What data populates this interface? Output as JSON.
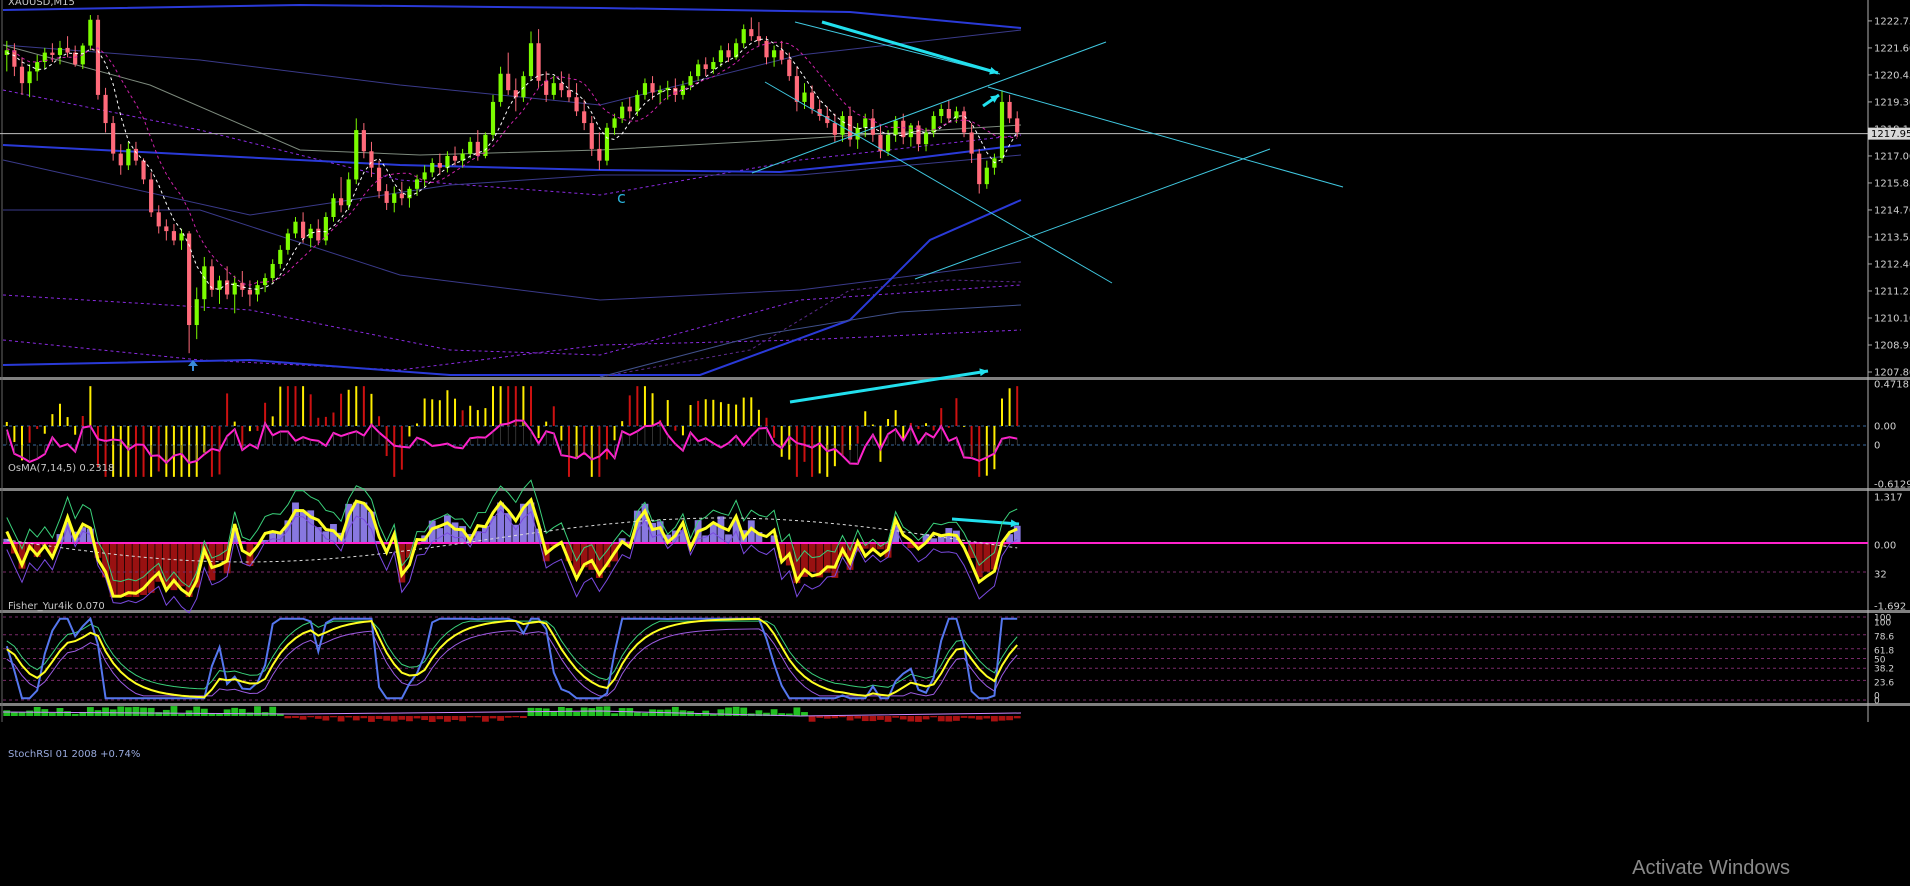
{
  "window": {
    "symbol_title": "XAUUSD,M15"
  },
  "watermark": "Activate Windows",
  "colors": {
    "background": "#000000",
    "bull_candle": "#7cfc00",
    "bear_candle": "#ff6a7a",
    "trendline": "#40c8e0",
    "arrow": "#22e0ee",
    "ma_blue": "#2a3ad8",
    "ma_purple": "#8a2be2",
    "signal_magenta": "#ff22cc",
    "osma_up": "#ffee00",
    "osma_down": "#cc1111",
    "fisher_line": "#ffff22",
    "fisher_pos": "#8878e0",
    "fisher_neg": "#991111",
    "stoch_blue": "#5577ee",
    "axis_text": "#d0d0d0",
    "separator": "#808080"
  },
  "chart_data": [
    {
      "panel": "price",
      "type": "candlestick",
      "title": "XAUUSD,M15",
      "y_ticks": [
        "1222.75",
        "1221.60",
        "1220.45",
        "1219.30",
        "1218.15",
        "1217.00",
        "1215.85",
        "1214.70",
        "1213.55",
        "1212.40",
        "1211.25",
        "1210.10",
        "1208.95",
        "1207.80"
      ],
      "ylim": [
        1207.8,
        1223.3
      ],
      "current_price": "1217.95",
      "annotation": "c",
      "candles": [
        [
          1221.3,
          1221.9,
          1220.6,
          1221.5
        ],
        [
          1221.5,
          1221.8,
          1220.4,
          1220.8
        ],
        [
          1220.8,
          1221.2,
          1219.6,
          1220.1
        ],
        [
          1220.1,
          1220.9,
          1219.5,
          1220.6
        ],
        [
          1220.6,
          1221.3,
          1220.2,
          1221.0
        ],
        [
          1221.0,
          1221.6,
          1220.7,
          1221.4
        ],
        [
          1221.4,
          1221.8,
          1221.0,
          1221.3
        ],
        [
          1221.3,
          1221.9,
          1220.9,
          1221.6
        ],
        [
          1221.6,
          1222.1,
          1221.2,
          1221.4
        ],
        [
          1221.4,
          1221.7,
          1220.8,
          1220.9
        ],
        [
          1220.9,
          1221.8,
          1220.7,
          1221.7
        ],
        [
          1221.7,
          1223.0,
          1221.5,
          1222.8
        ],
        [
          1222.8,
          1223.0,
          1219.4,
          1219.6
        ],
        [
          1219.6,
          1219.9,
          1218.0,
          1218.4
        ],
        [
          1218.4,
          1218.7,
          1216.8,
          1217.1
        ],
        [
          1217.1,
          1217.5,
          1216.2,
          1216.6
        ],
        [
          1216.6,
          1217.6,
          1216.4,
          1217.3
        ],
        [
          1217.3,
          1217.6,
          1216.6,
          1216.8
        ],
        [
          1216.8,
          1216.9,
          1215.8,
          1216.0
        ],
        [
          1216.0,
          1216.3,
          1214.4,
          1214.6
        ],
        [
          1214.6,
          1214.9,
          1213.7,
          1214.0
        ],
        [
          1214.0,
          1214.3,
          1213.4,
          1213.8
        ],
        [
          1213.8,
          1214.1,
          1213.2,
          1213.4
        ],
        [
          1213.4,
          1213.9,
          1213.0,
          1213.7
        ],
        [
          1213.7,
          1213.8,
          1208.6,
          1209.8
        ],
        [
          1209.8,
          1211.4,
          1209.2,
          1210.9
        ],
        [
          1210.9,
          1212.7,
          1210.4,
          1212.3
        ],
        [
          1212.3,
          1212.6,
          1211.0,
          1211.3
        ],
        [
          1211.3,
          1211.9,
          1210.7,
          1211.7
        ],
        [
          1211.7,
          1212.3,
          1210.9,
          1211.1
        ],
        [
          1211.1,
          1211.9,
          1210.3,
          1211.6
        ],
        [
          1211.6,
          1212.1,
          1211.0,
          1211.3
        ],
        [
          1211.3,
          1211.7,
          1210.6,
          1211.1
        ],
        [
          1211.1,
          1211.7,
          1210.8,
          1211.5
        ],
        [
          1211.5,
          1212.0,
          1211.2,
          1211.8
        ],
        [
          1211.8,
          1212.6,
          1211.6,
          1212.4
        ],
        [
          1212.4,
          1213.2,
          1212.2,
          1213.0
        ],
        [
          1213.0,
          1213.9,
          1212.8,
          1213.7
        ],
        [
          1213.7,
          1214.4,
          1213.5,
          1214.2
        ],
        [
          1214.2,
          1214.6,
          1213.3,
          1213.5
        ],
        [
          1213.5,
          1214.1,
          1213.1,
          1213.9
        ],
        [
          1213.9,
          1214.3,
          1213.2,
          1213.4
        ],
        [
          1213.4,
          1214.6,
          1213.2,
          1214.4
        ],
        [
          1214.4,
          1215.4,
          1214.2,
          1215.2
        ],
        [
          1215.2,
          1216.1,
          1214.6,
          1214.9
        ],
        [
          1214.9,
          1216.3,
          1214.7,
          1216.0
        ],
        [
          1216.0,
          1218.6,
          1215.8,
          1218.1
        ],
        [
          1218.1,
          1218.4,
          1216.9,
          1217.2
        ],
        [
          1217.2,
          1217.6,
          1216.1,
          1216.5
        ],
        [
          1216.5,
          1216.8,
          1215.2,
          1215.5
        ],
        [
          1215.5,
          1215.8,
          1214.7,
          1215.0
        ],
        [
          1215.0,
          1215.7,
          1214.6,
          1215.4
        ],
        [
          1215.4,
          1215.9,
          1214.9,
          1215.2
        ],
        [
          1215.2,
          1215.7,
          1214.8,
          1215.6
        ],
        [
          1215.6,
          1216.2,
          1215.3,
          1216.0
        ],
        [
          1216.0,
          1216.6,
          1215.7,
          1216.3
        ],
        [
          1216.3,
          1216.9,
          1216.1,
          1216.7
        ],
        [
          1216.7,
          1217.1,
          1216.2,
          1216.5
        ],
        [
          1216.5,
          1217.2,
          1216.3,
          1217.0
        ],
        [
          1217.0,
          1217.4,
          1216.6,
          1216.8
        ],
        [
          1216.8,
          1217.3,
          1216.5,
          1217.1
        ],
        [
          1217.1,
          1217.8,
          1216.9,
          1217.6
        ],
        [
          1217.6,
          1218.1,
          1216.8,
          1217.0
        ],
        [
          1217.0,
          1218.0,
          1216.9,
          1217.9
        ],
        [
          1217.9,
          1219.6,
          1217.7,
          1219.3
        ],
        [
          1219.3,
          1220.8,
          1219.1,
          1220.5
        ],
        [
          1220.5,
          1221.4,
          1219.6,
          1219.8
        ],
        [
          1219.8,
          1220.3,
          1218.9,
          1219.5
        ],
        [
          1219.5,
          1220.6,
          1219.3,
          1220.4
        ],
        [
          1220.4,
          1222.3,
          1220.2,
          1221.8
        ],
        [
          1221.8,
          1222.4,
          1219.9,
          1220.2
        ],
        [
          1220.2,
          1220.6,
          1219.3,
          1219.6
        ],
        [
          1219.6,
          1220.4,
          1219.4,
          1220.1
        ],
        [
          1220.1,
          1220.6,
          1219.5,
          1219.8
        ],
        [
          1219.8,
          1220.5,
          1219.3,
          1219.5
        ],
        [
          1219.5,
          1220.1,
          1218.7,
          1218.9
        ],
        [
          1218.9,
          1219.4,
          1218.1,
          1218.4
        ],
        [
          1218.4,
          1218.7,
          1217.0,
          1217.3
        ],
        [
          1217.3,
          1218.0,
          1216.4,
          1216.8
        ],
        [
          1216.8,
          1218.4,
          1216.6,
          1218.2
        ],
        [
          1218.2,
          1218.8,
          1217.9,
          1218.6
        ],
        [
          1218.6,
          1219.3,
          1218.4,
          1219.1
        ],
        [
          1219.1,
          1219.5,
          1218.6,
          1218.9
        ],
        [
          1218.9,
          1219.8,
          1218.7,
          1219.6
        ],
        [
          1219.6,
          1220.3,
          1219.4,
          1220.1
        ],
        [
          1220.1,
          1220.4,
          1219.4,
          1219.7
        ],
        [
          1219.7,
          1220.0,
          1219.2,
          1219.8
        ],
        [
          1219.8,
          1220.2,
          1219.4,
          1219.9
        ],
        [
          1219.9,
          1220.3,
          1219.3,
          1219.6
        ],
        [
          1219.6,
          1220.2,
          1219.4,
          1220.0
        ],
        [
          1220.0,
          1220.6,
          1219.8,
          1220.4
        ],
        [
          1220.4,
          1221.1,
          1220.2,
          1220.9
        ],
        [
          1220.9,
          1221.2,
          1220.4,
          1220.7
        ],
        [
          1220.7,
          1221.2,
          1220.5,
          1221.0
        ],
        [
          1221.0,
          1221.7,
          1220.8,
          1221.5
        ],
        [
          1221.5,
          1221.8,
          1221.0,
          1221.2
        ],
        [
          1221.2,
          1222.0,
          1221.1,
          1221.8
        ],
        [
          1221.8,
          1222.6,
          1221.6,
          1222.4
        ],
        [
          1222.4,
          1222.9,
          1221.9,
          1222.1
        ],
        [
          1222.1,
          1222.7,
          1221.7,
          1221.9
        ],
        [
          1221.9,
          1222.1,
          1220.9,
          1221.2
        ],
        [
          1221.2,
          1221.7,
          1220.8,
          1221.5
        ],
        [
          1221.5,
          1221.9,
          1220.9,
          1221.1
        ],
        [
          1221.1,
          1221.4,
          1220.2,
          1220.4
        ],
        [
          1220.4,
          1220.8,
          1218.9,
          1219.3
        ],
        [
          1219.3,
          1220.1,
          1219.0,
          1219.7
        ],
        [
          1219.7,
          1220.0,
          1218.8,
          1219.0
        ],
        [
          1219.0,
          1219.4,
          1218.5,
          1218.7
        ],
        [
          1218.7,
          1219.1,
          1218.2,
          1218.4
        ],
        [
          1218.4,
          1218.8,
          1217.6,
          1217.9
        ],
        [
          1217.9,
          1218.9,
          1217.6,
          1218.7
        ],
        [
          1218.7,
          1219.1,
          1217.4,
          1217.7
        ],
        [
          1217.7,
          1218.4,
          1217.3,
          1218.2
        ],
        [
          1218.2,
          1218.8,
          1217.8,
          1218.6
        ],
        [
          1218.6,
          1219.0,
          1217.6,
          1217.9
        ],
        [
          1217.9,
          1218.3,
          1216.9,
          1217.2
        ],
        [
          1217.2,
          1218.1,
          1217.0,
          1217.9
        ],
        [
          1217.9,
          1218.7,
          1217.6,
          1218.5
        ],
        [
          1218.5,
          1218.8,
          1217.5,
          1217.8
        ],
        [
          1217.8,
          1218.4,
          1217.4,
          1218.3
        ],
        [
          1218.3,
          1218.5,
          1217.2,
          1217.5
        ],
        [
          1217.5,
          1218.2,
          1217.2,
          1218.0
        ],
        [
          1218.0,
          1218.9,
          1217.8,
          1218.7
        ],
        [
          1218.7,
          1219.2,
          1218.4,
          1219.0
        ],
        [
          1219.0,
          1219.4,
          1218.4,
          1218.6
        ],
        [
          1218.6,
          1219.1,
          1218.4,
          1218.9
        ],
        [
          1218.9,
          1219.1,
          1217.8,
          1218.0
        ],
        [
          1218.0,
          1218.4,
          1216.7,
          1217.1
        ],
        [
          1217.1,
          1217.3,
          1215.4,
          1215.8
        ],
        [
          1215.8,
          1216.8,
          1215.6,
          1216.5
        ],
        [
          1216.5,
          1217.1,
          1216.2,
          1216.9
        ],
        [
          1216.9,
          1219.8,
          1216.7,
          1219.3
        ],
        [
          1219.3,
          1219.6,
          1218.4,
          1218.6
        ],
        [
          1218.6,
          1218.9,
          1217.8,
          1218.0
        ]
      ]
    },
    {
      "panel": "osma",
      "type": "bar",
      "title": "OsMA(7,14,5) 0.2318",
      "y_ticks": [
        "0.4718",
        "0.00",
        "0",
        "-0.6129"
      ],
      "ylim": [
        -0.6129,
        0.4718
      ]
    },
    {
      "panel": "fisher",
      "type": "area",
      "title": "Fisher_Yur4ik 0.070",
      "y_ticks": [
        "1.317",
        "0.00",
        "32",
        "-1.692"
      ],
      "ylim": [
        -1.692,
        1.317
      ]
    },
    {
      "panel": "stochrsi",
      "type": "line",
      "title": "StochRSI 01 2008 +0.74%",
      "y_ticks": [
        "100",
        "100",
        "78.6",
        "61.8",
        "50",
        "38.2",
        "23.6",
        "0",
        "0"
      ],
      "ylim": [
        0,
        100
      ]
    }
  ]
}
